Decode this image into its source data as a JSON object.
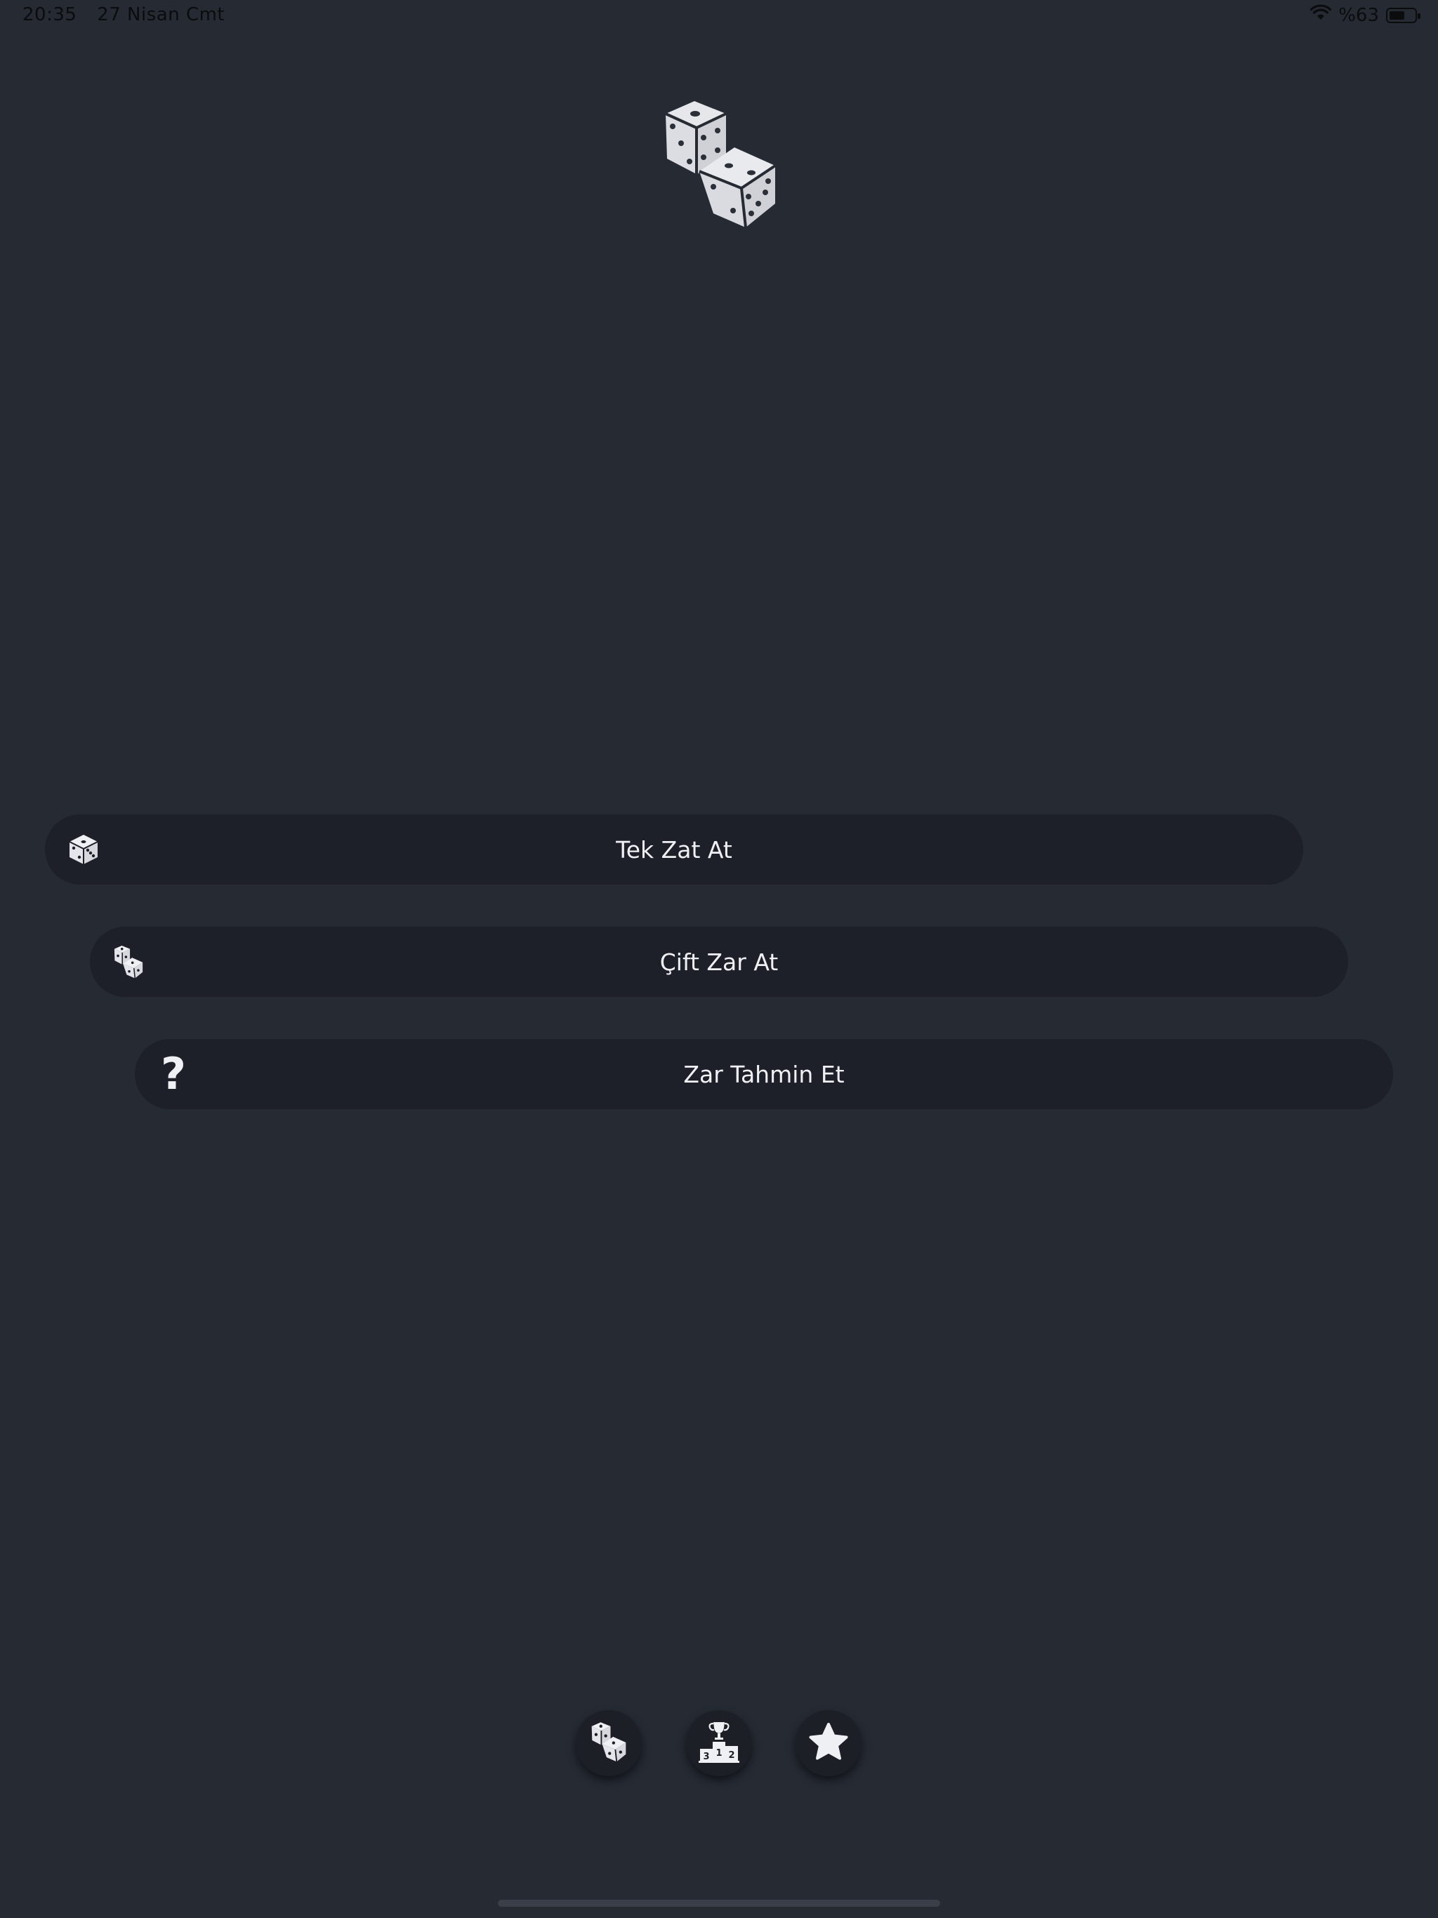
{
  "status_bar": {
    "time": "20:35",
    "date": "27 Nisan Cmt",
    "battery_text": "%63",
    "battery_level": 0.63
  },
  "logo": {
    "icon": "dice-pair-icon"
  },
  "menu": {
    "buttons": [
      {
        "label": "Tek Zat At",
        "icon": "single-die-icon"
      },
      {
        "label": "Çift Zar At",
        "icon": "two-dice-icon"
      },
      {
        "label": "Zar Tahmin Et",
        "icon": "question-mark-icon",
        "icon_glyph": "?"
      }
    ]
  },
  "bottom_nav": {
    "buttons": [
      {
        "icon": "dice-icon"
      },
      {
        "icon": "podium-trophy-icon",
        "podium_numbers": [
          "3",
          "1",
          "2"
        ]
      },
      {
        "icon": "star-icon"
      }
    ]
  },
  "colors": {
    "background": "#252a33",
    "button_background": "#1d2028",
    "foreground": "#eef0f4"
  }
}
